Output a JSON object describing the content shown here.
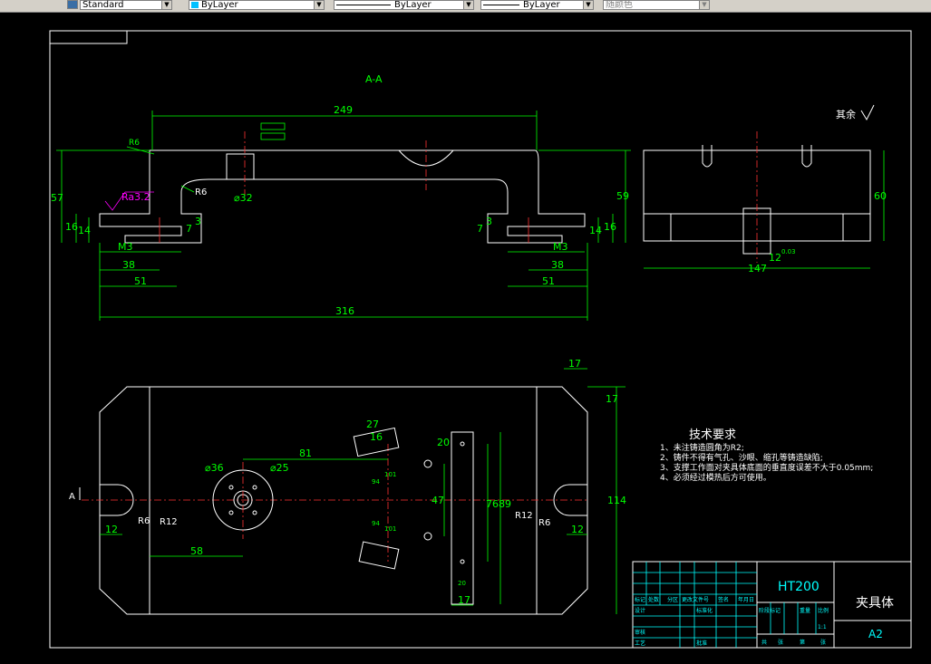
{
  "toolbar": {
    "style": "Standard",
    "layer": "ByLayer",
    "linetype": "ByLayer",
    "lineweight": "ByLayer",
    "color": "随颜色"
  },
  "drawing": {
    "section_label": "A-A",
    "roughness_note": "其余",
    "ra": "Ra3.2",
    "dims": {
      "d249": "249",
      "d316": "316",
      "d57": "57",
      "d59": "59",
      "d16a": "16",
      "d14a": "14",
      "d16b": "16",
      "d14b": "14",
      "d7a": "7",
      "d3a": "3",
      "d7b": "7",
      "d3b": "3",
      "m3a": "M3",
      "m3b": "M3",
      "d38a": "38",
      "d38b": "38",
      "d51a": "51",
      "d51b": "51",
      "r6a": "R6",
      "r6b": "R6",
      "phi32": "⌀32",
      "d60": "60",
      "d147": "147",
      "d12": "12",
      "d12tol": "0.03",
      "d17a": "17",
      "d17b": "17",
      "d81": "81",
      "phi36": "⌀36",
      "phi25": "⌀25",
      "d58": "58",
      "d12c": "12",
      "d12d": "12",
      "r6c": "R6",
      "r12a": "R12",
      "r12b": "R12",
      "r6d": "R6",
      "d27": "27",
      "d16c": "16",
      "d20a": "20",
      "d47": "47",
      "d76": "76",
      "d89": "89",
      "d114": "114",
      "d17c": "17",
      "d20b": "20",
      "d94a": "94",
      "d94b": "94",
      "d101a": "101",
      "d101b": "101",
      "sec_a_left": "A",
      "sec_a_right": "A"
    }
  },
  "tech": {
    "title": "技术要求",
    "items": [
      "1、未注铸造圆角为R2;",
      "2、铸件不得有气孔、沙眼、缩孔等铸造缺陷;",
      "3、支撑工作面对夹具体底面的垂直度误差不大于0.05mm;",
      "4、必须经过模热后方可使用。"
    ]
  },
  "titleblock": {
    "material": "HT200",
    "name": "夹具体",
    "size": "A2",
    "scale": "1:1",
    "labels": [
      "标记",
      "处数",
      "分区",
      "更改文件号",
      "签名",
      "年月日",
      "设计",
      "标准化",
      "阶段标记",
      "重量",
      "比例",
      "审核",
      "工艺",
      "批准",
      "共",
      "张",
      "第",
      "张"
    ]
  }
}
